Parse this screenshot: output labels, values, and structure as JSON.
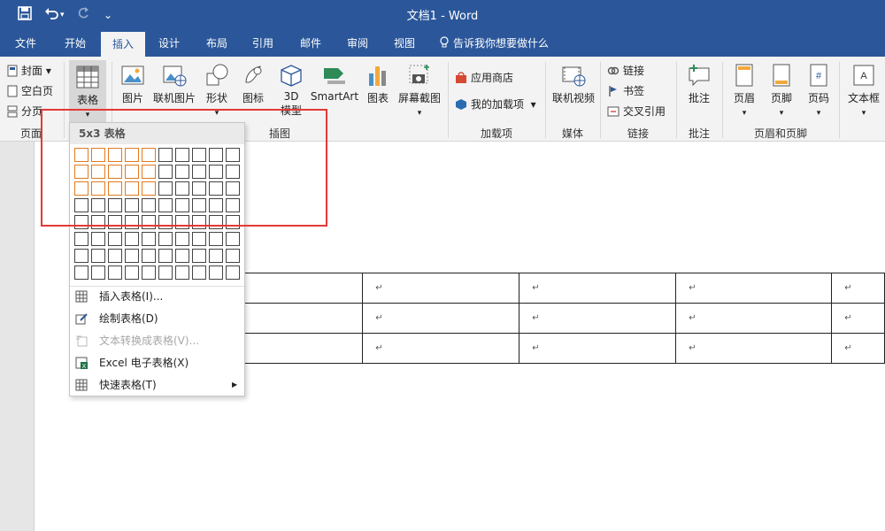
{
  "window": {
    "title": "文档1  -  Word"
  },
  "quick_access": {
    "save_icon": "save-icon",
    "undo_icon": "undo-icon",
    "redo_icon": "redo-icon",
    "customize_glyph": "⌄"
  },
  "tabs": [
    "文件",
    "开始",
    "插入",
    "设计",
    "布局",
    "引用",
    "邮件",
    "审阅",
    "视图"
  ],
  "active_tab": "插入",
  "tell_me": "告诉我你想要做什么",
  "ribbon": {
    "pages_group": {
      "items": [
        "封面",
        "空白页",
        "分页"
      ],
      "label": "页面"
    },
    "tables_group": {
      "button": "表格"
    },
    "illustrations_group": {
      "buttons": [
        "图片",
        "联机图片",
        "形状",
        "图标",
        "3D",
        "SmartArt",
        "图表",
        "屏幕截图"
      ],
      "model_label": "模型",
      "label": "插图"
    },
    "addins_group": {
      "items": [
        "应用商店",
        "我的加载项"
      ],
      "label": "加载项"
    },
    "media_group": {
      "button": "联机视频",
      "label": "媒体"
    },
    "links_group": {
      "items": [
        "链接",
        "书签",
        "交叉引用"
      ],
      "label": "链接"
    },
    "comments_group": {
      "button": "批注",
      "label": "批注"
    },
    "header_footer_group": {
      "buttons": [
        "页眉",
        "页脚",
        "页码"
      ],
      "label": "页眉和页脚"
    },
    "text_group": {
      "button": "文本框"
    }
  },
  "table_dropdown": {
    "header": "5x3 表格",
    "grid_cols": 10,
    "grid_rows": 8,
    "selected_cols": 5,
    "selected_rows": 3,
    "menu": [
      {
        "label": "插入表格(I)...",
        "enabled": true
      },
      {
        "label": "绘制表格(D)",
        "enabled": true
      },
      {
        "label": "文本转换成表格(V)...",
        "enabled": false
      },
      {
        "label": "Excel 电子表格(X)",
        "enabled": true
      },
      {
        "label": "快速表格(T)",
        "enabled": true
      }
    ]
  },
  "document": {
    "cell_mark": "↵",
    "rows": 3,
    "cols": 5
  },
  "colors": {
    "title_bar": "#2b579a",
    "grid_highlight": "#e07b1f",
    "annotation_box": "#e53935"
  }
}
